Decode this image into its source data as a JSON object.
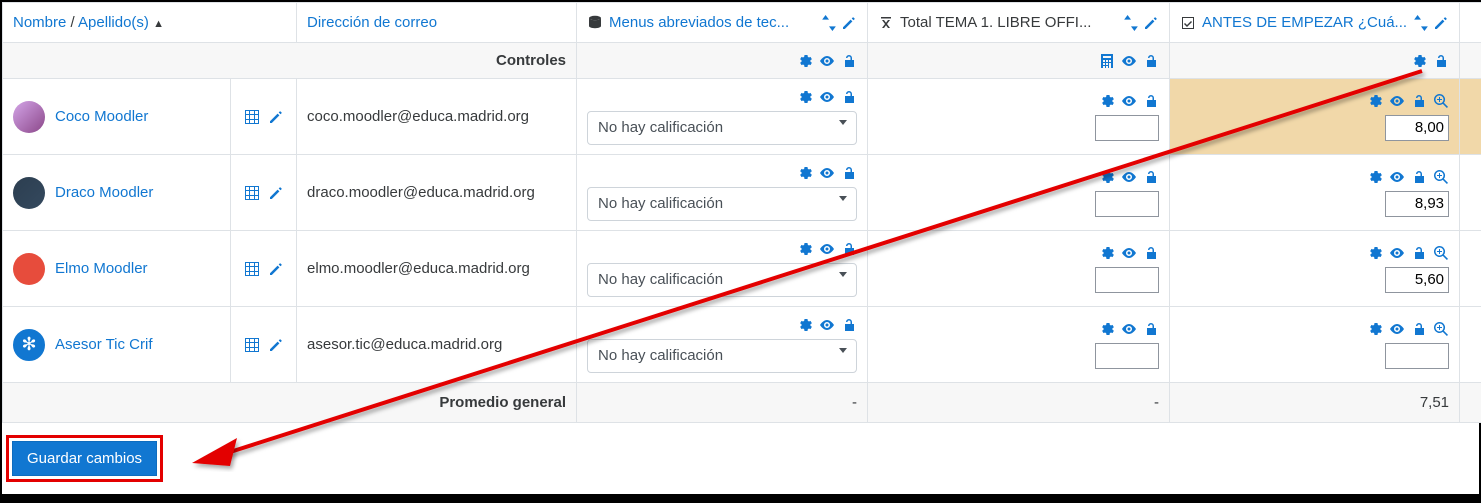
{
  "headers": {
    "name": "Nombre",
    "surname": "Apellido(s)",
    "sep": " / ",
    "email": "Dirección de correo",
    "col3": "Menus abreviados de tec...",
    "col4": "Total TEMA 1. LIBRE OFFI...",
    "col5": "ANTES DE EMPEZAR ¿Cuá..."
  },
  "controls_label": "Controles",
  "select_placeholder": "No hay calificación",
  "students": [
    {
      "name": "Coco Moodler",
      "email": "coco.moodler@educa.madrid.org",
      "total": "",
      "grade": "8,00",
      "highlight": true
    },
    {
      "name": "Draco Moodler",
      "email": "draco.moodler@educa.madrid.org",
      "total": "",
      "grade": "8,93",
      "highlight": false
    },
    {
      "name": "Elmo Moodler",
      "email": "elmo.moodler@educa.madrid.org",
      "total": "",
      "grade": "5,60",
      "highlight": false
    },
    {
      "name": "Asesor Tic Crif",
      "email": "asesor.tic@educa.madrid.org",
      "total": "",
      "grade": "",
      "highlight": false
    }
  ],
  "average": {
    "label": "Promedio general",
    "col3": "-",
    "col4": "-",
    "col5": "7,51"
  },
  "save_button": "Guardar cambios"
}
